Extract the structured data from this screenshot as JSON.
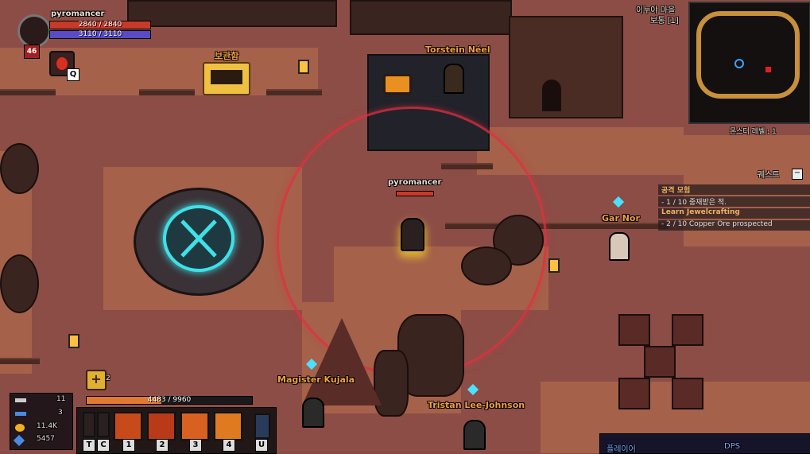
{
  "player": {
    "name": "pyromancer",
    "level": "46",
    "hp_text": "2840 / 2840",
    "hp_fraction": 1.0,
    "mana_text": "3110 / 3110",
    "mana_fraction": 1.0,
    "xp_text": "4483 / 9960",
    "xp_fraction": 0.45
  },
  "map": {
    "zone_name": "이누야 마을",
    "difficulty": "보통 [1]",
    "monster_level": "몬스터 레벨 : 1"
  },
  "npcs": {
    "storage": "보관함",
    "torstein": "Torstein Néel",
    "gar_nor": "Gar Nor",
    "magister": "Magister Kujala",
    "tristan": "Tristan Lee-Johnson"
  },
  "quests": {
    "header": "퀘스트",
    "items": [
      {
        "title": "공격 모험",
        "progress": "- 1 / 10 중재받은 적."
      },
      {
        "title": "Learn Jewelcrafting",
        "progress": "- 2 / 10 Copper Ore prospected"
      }
    ]
  },
  "resources": {
    "keys_silver": "11",
    "keys_blue": "3",
    "gold": "11.4K",
    "gems": "5457"
  },
  "skillbar": {
    "keys": [
      "T",
      "C",
      "1",
      "2",
      "3",
      "4",
      "U"
    ],
    "potion_key": "Q",
    "attribute_points": "2"
  },
  "bottom_panel": {
    "player_label": "플레이어",
    "dps_label": "DPS"
  },
  "colors": {
    "accent_orange": "#f0a040",
    "hp_red": "#c83a28",
    "mana_blue": "#5a4ac8",
    "portal_cyan": "#3fe0e8",
    "aoe_ring": "#e03040"
  }
}
